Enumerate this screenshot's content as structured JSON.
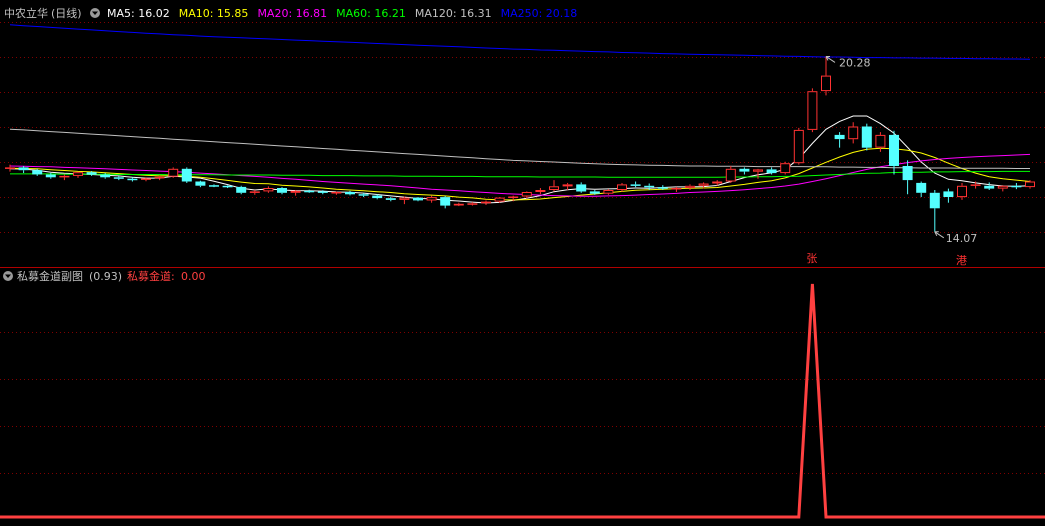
{
  "main_panel": {
    "stock_name": "中农立华",
    "period": "(日线)",
    "ma": [
      {
        "label": "MA5:",
        "value": "16.02",
        "color": "#ffffff"
      },
      {
        "label": "MA10:",
        "value": "15.85",
        "color": "#ffff00"
      },
      {
        "label": "MA20:",
        "value": "16.81",
        "color": "#ff00ff"
      },
      {
        "label": "MA60:",
        "value": "16.21",
        "color": "#00ff00"
      },
      {
        "label": "MA120:",
        "value": "16.31",
        "color": "#c0c0c0"
      },
      {
        "label": "MA250:",
        "value": "20.18",
        "color": "#0000ff"
      }
    ],
    "high_annotation": "20.28",
    "low_annotation": "14.07",
    "marker_up": "张",
    "marker_down": "港"
  },
  "sub_panel": {
    "indicator_name": "私募金道副图",
    "param": "(0.93)",
    "series_label": "私募金道:",
    "series_value": "0.00",
    "series_color": "#ff4040"
  },
  "colors": {
    "up": "#ff3232",
    "down": "#54ffff",
    "grid": "#800000",
    "border": "#b00000",
    "title_text": "#c0c0c0"
  },
  "chart_data": [
    {
      "type": "candlestick",
      "title": "中农立华 (日线)",
      "ylim": [
        13.0,
        21.5
      ],
      "candles": [
        [
          16.3,
          16.45,
          16.2,
          16.35
        ],
        [
          16.35,
          16.4,
          16.15,
          16.25
        ],
        [
          16.25,
          16.3,
          16.05,
          16.1
        ],
        [
          16.1,
          16.15,
          15.95,
          16.0
        ],
        [
          16.0,
          16.1,
          15.9,
          16.05
        ],
        [
          16.05,
          16.2,
          15.98,
          16.18
        ],
        [
          16.18,
          16.22,
          16.05,
          16.1
        ],
        [
          16.1,
          16.15,
          15.95,
          16.0
        ],
        [
          16.0,
          16.05,
          15.9,
          15.95
        ],
        [
          15.95,
          16.0,
          15.85,
          15.92
        ],
        [
          15.92,
          16.0,
          15.86,
          15.96
        ],
        [
          15.96,
          16.05,
          15.9,
          16.02
        ],
        [
          16.02,
          16.35,
          15.98,
          16.3
        ],
        [
          16.3,
          16.35,
          15.8,
          15.85
        ],
        [
          15.85,
          15.88,
          15.65,
          15.7
        ],
        [
          15.72,
          15.75,
          15.65,
          15.7
        ],
        [
          15.7,
          15.72,
          15.62,
          15.66
        ],
        [
          15.66,
          15.7,
          15.4,
          15.45
        ],
        [
          15.45,
          15.55,
          15.38,
          15.5
        ],
        [
          15.5,
          15.68,
          15.45,
          15.62
        ],
        [
          15.62,
          15.65,
          15.4,
          15.45
        ],
        [
          15.45,
          15.55,
          15.35,
          15.52
        ],
        [
          15.52,
          15.56,
          15.45,
          15.5
        ],
        [
          15.5,
          15.54,
          15.4,
          15.46
        ],
        [
          15.46,
          15.5,
          15.38,
          15.48
        ],
        [
          15.48,
          15.52,
          15.36,
          15.4
        ],
        [
          15.4,
          15.45,
          15.3,
          15.35
        ],
        [
          15.35,
          15.4,
          15.22,
          15.26
        ],
        [
          15.26,
          15.3,
          15.15,
          15.2
        ],
        [
          15.2,
          15.32,
          15.05,
          15.28
        ],
        [
          15.28,
          15.3,
          15.15,
          15.18
        ],
        [
          15.18,
          15.35,
          15.1,
          15.3
        ],
        [
          15.3,
          15.34,
          14.9,
          15.0
        ],
        [
          15.0,
          15.1,
          14.98,
          15.06
        ],
        [
          15.06,
          15.12,
          15.0,
          15.08
        ],
        [
          15.08,
          15.18,
          15.02,
          15.14
        ],
        [
          15.14,
          15.3,
          15.1,
          15.28
        ],
        [
          15.28,
          15.35,
          15.15,
          15.32
        ],
        [
          15.32,
          15.5,
          15.25,
          15.48
        ],
        [
          15.48,
          15.62,
          15.4,
          15.55
        ],
        [
          15.55,
          15.9,
          15.5,
          15.68
        ],
        [
          15.68,
          15.8,
          15.55,
          15.75
        ],
        [
          15.75,
          15.82,
          15.45,
          15.5
        ],
        [
          15.5,
          15.55,
          15.38,
          15.42
        ],
        [
          15.42,
          15.58,
          15.38,
          15.55
        ],
        [
          15.55,
          15.8,
          15.48,
          15.75
        ],
        [
          15.75,
          15.85,
          15.65,
          15.7
        ],
        [
          15.7,
          15.78,
          15.55,
          15.65
        ],
        [
          15.65,
          15.72,
          15.55,
          15.6
        ],
        [
          15.6,
          15.66,
          15.48,
          15.62
        ],
        [
          15.62,
          15.75,
          15.55,
          15.7
        ],
        [
          15.7,
          15.82,
          15.6,
          15.78
        ],
        [
          15.78,
          15.9,
          15.7,
          15.85
        ],
        [
          15.85,
          16.4,
          15.8,
          16.3
        ],
        [
          16.3,
          16.35,
          16.1,
          16.2
        ],
        [
          16.2,
          16.3,
          15.95,
          16.28
        ],
        [
          16.28,
          16.35,
          16.1,
          16.15
        ],
        [
          16.15,
          16.55,
          16.1,
          16.5
        ],
        [
          16.5,
          17.75,
          16.45,
          17.68
        ],
        [
          17.68,
          19.15,
          17.6,
          19.05
        ],
        [
          19.05,
          20.28,
          18.9,
          19.6
        ],
        [
          17.5,
          17.6,
          17.05,
          17.35
        ],
        [
          17.35,
          17.95,
          17.2,
          17.8
        ],
        [
          17.8,
          17.9,
          16.95,
          17.05
        ],
        [
          17.05,
          17.6,
          16.9,
          17.5
        ],
        [
          17.5,
          17.65,
          16.1,
          16.4
        ],
        [
          16.4,
          16.6,
          15.4,
          15.9
        ],
        [
          15.8,
          15.85,
          15.3,
          15.45
        ],
        [
          15.45,
          15.55,
          14.07,
          14.9
        ],
        [
          15.5,
          15.6,
          15.1,
          15.3
        ],
        [
          15.3,
          15.8,
          15.2,
          15.7
        ],
        [
          15.7,
          15.85,
          15.6,
          15.75
        ],
        [
          15.7,
          15.82,
          15.55,
          15.6
        ],
        [
          15.6,
          15.72,
          15.5,
          15.7
        ],
        [
          15.7,
          15.8,
          15.58,
          15.65
        ],
        [
          15.65,
          15.9,
          15.6,
          15.85
        ]
      ],
      "ma_series": [
        {
          "name": "MA5",
          "values": [
            16.3,
            16.29,
            16.25,
            16.18,
            16.14,
            16.12,
            16.1,
            16.07,
            16.05,
            16.0,
            15.97,
            15.97,
            16.04,
            16.01,
            15.97,
            15.86,
            15.74,
            15.61,
            15.55,
            15.59,
            15.55,
            15.53,
            15.52,
            15.51,
            15.48,
            15.47,
            15.44,
            15.39,
            15.34,
            15.3,
            15.25,
            15.24,
            15.19,
            15.16,
            15.12,
            15.09,
            15.11,
            15.18,
            15.26,
            15.35,
            15.49,
            15.56,
            15.6,
            15.58,
            15.59,
            15.6,
            15.62,
            15.61,
            15.64,
            15.66,
            15.66,
            15.67,
            15.71,
            15.85,
            15.99,
            16.09,
            16.16,
            16.28,
            16.66,
            17.2,
            17.7,
            17.98,
            18.17,
            18.17,
            17.9,
            17.56,
            17.06,
            16.54,
            16.15,
            15.93,
            15.88,
            15.8,
            15.74,
            15.69,
            15.68,
            15.7
          ]
        },
        {
          "name": "MA10",
          "values": [
            16.32,
            16.31,
            16.3,
            16.27,
            16.24,
            16.21,
            16.19,
            16.16,
            16.13,
            16.1,
            16.07,
            16.05,
            16.06,
            16.04,
            16.0,
            15.95,
            15.89,
            15.83,
            15.78,
            15.77,
            15.72,
            15.69,
            15.66,
            15.62,
            15.58,
            15.55,
            15.52,
            15.49,
            15.46,
            15.42,
            15.39,
            15.37,
            15.34,
            15.3,
            15.27,
            15.22,
            15.2,
            15.2,
            15.21,
            15.23,
            15.28,
            15.32,
            15.37,
            15.41,
            15.45,
            15.5,
            15.54,
            15.56,
            15.58,
            15.6,
            15.61,
            15.62,
            15.64,
            15.69,
            15.75,
            15.82,
            15.88,
            15.98,
            16.13,
            16.33,
            16.53,
            16.72,
            16.88,
            16.99,
            17.03,
            17.01,
            16.96,
            16.86,
            16.7,
            16.5,
            16.31,
            16.15,
            16.02,
            15.95,
            15.9,
            15.85
          ]
        },
        {
          "name": "MA20",
          "values": [
            16.4,
            16.39,
            16.38,
            16.37,
            16.35,
            16.34,
            16.32,
            16.3,
            16.28,
            16.26,
            16.24,
            16.22,
            16.2,
            16.18,
            16.15,
            16.12,
            16.09,
            16.06,
            16.03,
            16.0,
            15.96,
            15.93,
            15.89,
            15.85,
            15.82,
            15.79,
            15.76,
            15.73,
            15.7,
            15.66,
            15.62,
            15.58,
            15.55,
            15.52,
            15.49,
            15.46,
            15.43,
            15.41,
            15.39,
            15.37,
            15.35,
            15.34,
            15.33,
            15.33,
            15.34,
            15.35,
            15.37,
            15.39,
            15.41,
            15.43,
            15.46,
            15.48,
            15.5,
            15.53,
            15.56,
            15.6,
            15.64,
            15.69,
            15.76,
            15.85,
            15.95,
            16.06,
            16.17,
            16.28,
            16.37,
            16.45,
            16.52,
            16.58,
            16.63,
            16.67,
            16.7,
            16.73,
            16.75,
            16.77,
            16.79,
            16.81
          ]
        },
        {
          "name": "MA60",
          "values": [
            16.12,
            16.12,
            16.12,
            16.12,
            16.11,
            16.11,
            16.11,
            16.11,
            16.1,
            16.1,
            16.1,
            16.1,
            16.09,
            16.09,
            16.09,
            16.09,
            16.08,
            16.08,
            16.08,
            16.08,
            16.07,
            16.07,
            16.07,
            16.06,
            16.06,
            16.06,
            16.05,
            16.05,
            16.05,
            16.04,
            16.04,
            16.04,
            16.03,
            16.03,
            16.03,
            16.02,
            16.02,
            16.02,
            16.02,
            16.01,
            16.01,
            16.01,
            16.01,
            16.01,
            16.0,
            16.0,
            16.0,
            16.0,
            16.0,
            16.0,
            16.0,
            16.0,
            16.0,
            16.01,
            16.01,
            16.02,
            16.02,
            16.03,
            16.04,
            16.06,
            16.08,
            16.1,
            16.12,
            16.14,
            16.15,
            16.17,
            16.18,
            16.18,
            16.19,
            16.19,
            16.2,
            16.2,
            16.2,
            16.21,
            16.21,
            16.21
          ]
        },
        {
          "name": "MA120",
          "values": [
            17.7,
            17.68,
            17.65,
            17.62,
            17.59,
            17.56,
            17.53,
            17.5,
            17.47,
            17.44,
            17.41,
            17.38,
            17.35,
            17.32,
            17.29,
            17.26,
            17.23,
            17.2,
            17.17,
            17.14,
            17.11,
            17.08,
            17.05,
            17.02,
            16.99,
            16.96,
            16.93,
            16.9,
            16.87,
            16.84,
            16.81,
            16.78,
            16.75,
            16.72,
            16.69,
            16.66,
            16.63,
            16.6,
            16.58,
            16.56,
            16.54,
            16.52,
            16.5,
            16.48,
            16.46,
            16.45,
            16.44,
            16.43,
            16.42,
            16.41,
            16.4,
            16.4,
            16.39,
            16.39,
            16.39,
            16.38,
            16.38,
            16.38,
            16.38,
            16.37,
            16.37,
            16.36,
            16.36,
            16.35,
            16.35,
            16.34,
            16.34,
            16.33,
            16.33,
            16.33,
            16.32,
            16.32,
            16.32,
            16.32,
            16.31,
            16.31
          ]
        },
        {
          "name": "MA250",
          "values": [
            21.4,
            21.37,
            21.34,
            21.31,
            21.28,
            21.25,
            21.22,
            21.19,
            21.16,
            21.13,
            21.1,
            21.08,
            21.05,
            21.03,
            21.0,
            20.98,
            20.96,
            20.94,
            20.92,
            20.9,
            20.88,
            20.86,
            20.84,
            20.82,
            20.8,
            20.78,
            20.76,
            20.74,
            20.72,
            20.7,
            20.68,
            20.66,
            20.64,
            20.62,
            20.6,
            20.58,
            20.56,
            20.54,
            20.53,
            20.51,
            20.5,
            20.48,
            20.47,
            20.45,
            20.44,
            20.42,
            20.41,
            20.4,
            20.38,
            20.37,
            20.36,
            20.35,
            20.34,
            20.33,
            20.32,
            20.31,
            20.3,
            20.29,
            20.28,
            20.27,
            20.26,
            20.26,
            20.25,
            20.24,
            20.24,
            20.23,
            20.23,
            20.22,
            20.22,
            20.21,
            20.21,
            20.2,
            20.2,
            20.19,
            20.19,
            20.18
          ]
        }
      ]
    },
    {
      "type": "line",
      "title": "私募金道副图(0.93)",
      "ylim": [
        0,
        1.0
      ],
      "series": [
        {
          "name": "私募金道",
          "values": [
            0,
            0,
            0,
            0,
            0,
            0,
            0,
            0,
            0,
            0,
            0,
            0,
            0,
            0,
            0,
            0,
            0,
            0,
            0,
            0,
            0,
            0,
            0,
            0,
            0,
            0,
            0,
            0,
            0,
            0,
            0,
            0,
            0,
            0,
            0,
            0,
            0,
            0,
            0,
            0,
            0,
            0,
            0,
            0,
            0,
            0,
            0,
            0,
            0,
            0,
            0,
            0,
            0,
            0,
            0,
            0,
            0,
            0,
            0,
            1,
            0,
            0,
            0,
            0,
            0,
            0,
            0,
            0,
            0,
            0,
            0,
            0,
            0,
            0,
            0,
            0
          ]
        }
      ]
    }
  ]
}
